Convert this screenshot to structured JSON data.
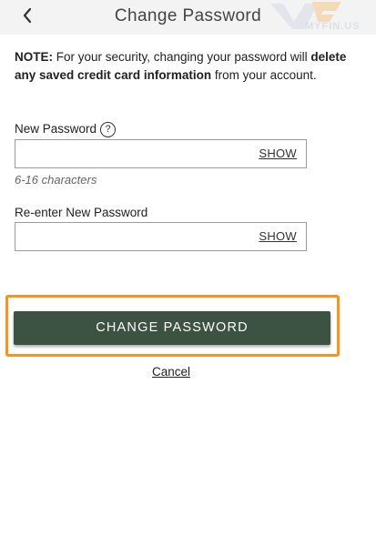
{
  "header": {
    "back_icon": "chevron-left-icon",
    "title": "Change Password",
    "watermark_text": "MYFIN.US"
  },
  "note": {
    "prefix": "NOTE:",
    "text_1": " For your security, changing your password will ",
    "bold_text": "delete any saved credit card information",
    "text_2": " from your account."
  },
  "new_password": {
    "label": "New Password",
    "help_icon": "question-circle-icon",
    "help_glyph": "?",
    "value": "",
    "placeholder": "",
    "show_label": "SHOW",
    "hint": "6-16 characters"
  },
  "reenter_password": {
    "label": "Re-enter New Password",
    "value": "",
    "placeholder": "",
    "show_label": "SHOW"
  },
  "actions": {
    "submit_label": "CHANGE PASSWORD",
    "cancel_label": "Cancel"
  },
  "colors": {
    "header_bg": "#f3f3f3",
    "primary_button": "#3c5242",
    "highlight": "#f7941d"
  }
}
